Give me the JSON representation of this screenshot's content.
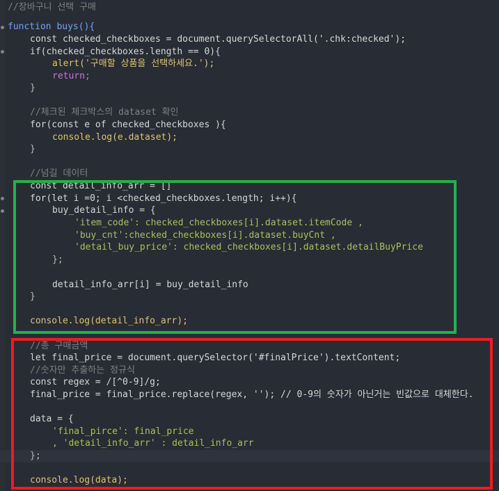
{
  "code_lines": [
    "//장바구니 선택 구매",
    "function buys(){",
    "const checked_checkboxes = document.querySelectorAll('.chk:checked');",
    "if(checked_checkboxes.length == 0){",
    "alert('구매할 상품을 선택하세요.');",
    "return;",
    "}",
    "",
    "//체크된 체크박스의 dataset 확인",
    "for(const e of checked_checkboxes ){",
    "console.log(e.dataset);",
    "}",
    "",
    "//넘길 데이터",
    "const detail_info_arr = []",
    "for(let i =0; i <checked_checkboxes.length; i++){",
    "buy_detail_info = {",
    "'item_code': checked_checkboxes[i].dataset.itemCode ,",
    "'buy_cnt':checked_checkboxes[i].dataset.buyCnt ,",
    "'detail_buy_price': checked_checkboxes[i].dataset.detailBuyPrice",
    "};",
    "",
    "detail_info_arr[i] = buy_detail_info",
    "}",
    "",
    "console.log(detail_info_arr);",
    "",
    "//총 구매금액",
    "let final_price = document.querySelector('#finalPrice').textContent;",
    "//숫자만 추출하는 정규식",
    "const regex = /[^0-9]/g;",
    "final_price = final_price.replace(regex, ''); // 0-9의 숫자가 아닌거는 빈값으로 대체한다.",
    "",
    "data = {",
    "'final_pirce': final_price",
    ", 'detail_info_arr' : detail_info_arr",
    "};",
    "",
    "console.log(data);"
  ],
  "highlight_colors": {
    "green_box": "#22b14c",
    "red_box": "#ed1c24",
    "background": "#282c34"
  }
}
